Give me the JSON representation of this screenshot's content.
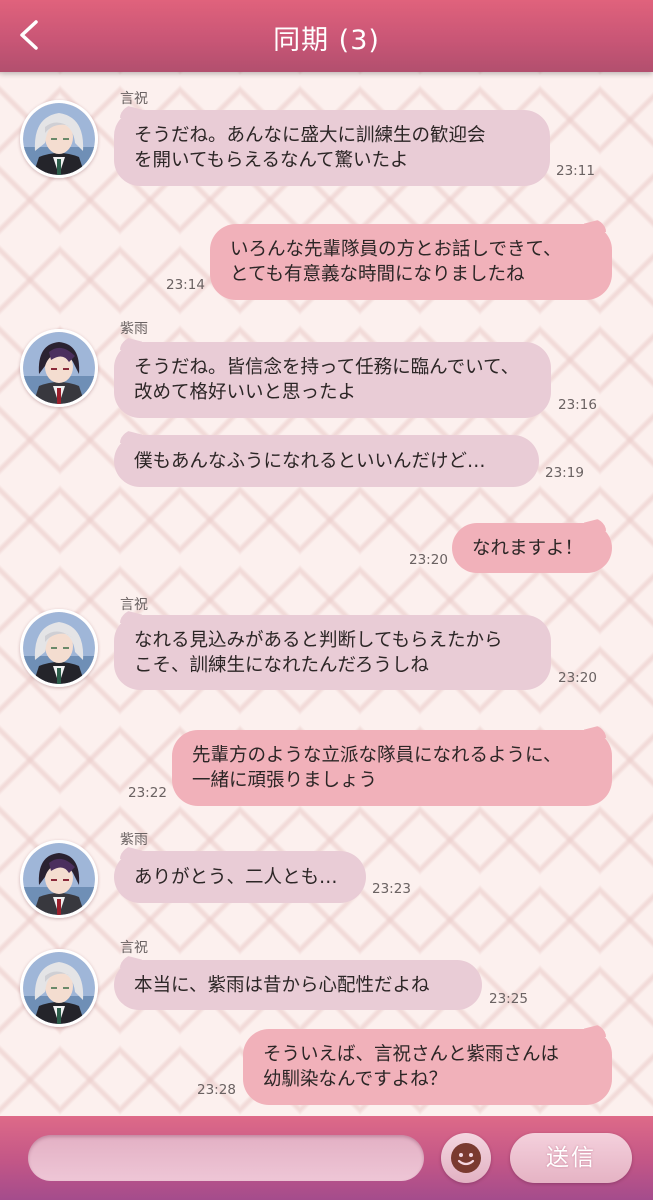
{
  "header": {
    "back_icon": "chevron-left-icon",
    "title": "同期 (3)"
  },
  "messages": [
    {
      "sender": "言祝",
      "avatar": "kotohogi",
      "lines": [
        "そうだね。あんなに盛大に訓練生の歓迎会",
        "を開いてもらえるなんて驚いたよ"
      ],
      "time": "23:11"
    },
    {
      "sender": "",
      "lines": [
        "いろんな先輩隊員の方とお話しできて、",
        "とても有意義な時間になりましたね"
      ],
      "time": "23:14"
    },
    {
      "sender": "紫雨",
      "avatar": "shigure",
      "lines": [
        "そうだね。皆信念を持って任務に臨んでいて、",
        "改めて格好いいと思ったよ"
      ],
      "time": "23:16"
    },
    {
      "sender": "",
      "lines": [
        "僕もあんなふうになれるといいんだけど…"
      ],
      "time": "23:19"
    },
    {
      "sender": "",
      "lines": [
        "なれますよ！"
      ],
      "time": "23:20"
    },
    {
      "sender": "言祝",
      "avatar": "kotohogi",
      "lines": [
        "なれる見込みがあると判断してもらえたから",
        "こそ、訓練生になれたんだろうしね"
      ],
      "time": "23:20"
    },
    {
      "sender": "",
      "lines": [
        "先輩方のような立派な隊員になれるように、",
        "一緒に頑張りましょう"
      ],
      "time": "23:22"
    },
    {
      "sender": "紫雨",
      "avatar": "shigure",
      "lines": [
        "ありがとう、二人とも…"
      ],
      "time": "23:23"
    },
    {
      "sender": "言祝",
      "avatar": "kotohogi",
      "lines": [
        "本当に、紫雨は昔から心配性だよね"
      ],
      "time": "23:25"
    },
    {
      "sender": "",
      "lines": [
        "そういえば、言祝さんと紫雨さんは",
        "幼馴染なんですよね？"
      ],
      "time": "23:28"
    }
  ],
  "footer": {
    "input_value": "",
    "input_placeholder": "",
    "emoji_icon": "face-icon",
    "send_label": "送信"
  },
  "colors": {
    "header": "#c95676",
    "bubble_incoming": "#e9ccd6",
    "bubble_outgoing": "#f1b1ba",
    "background": "#fcf0ee"
  }
}
